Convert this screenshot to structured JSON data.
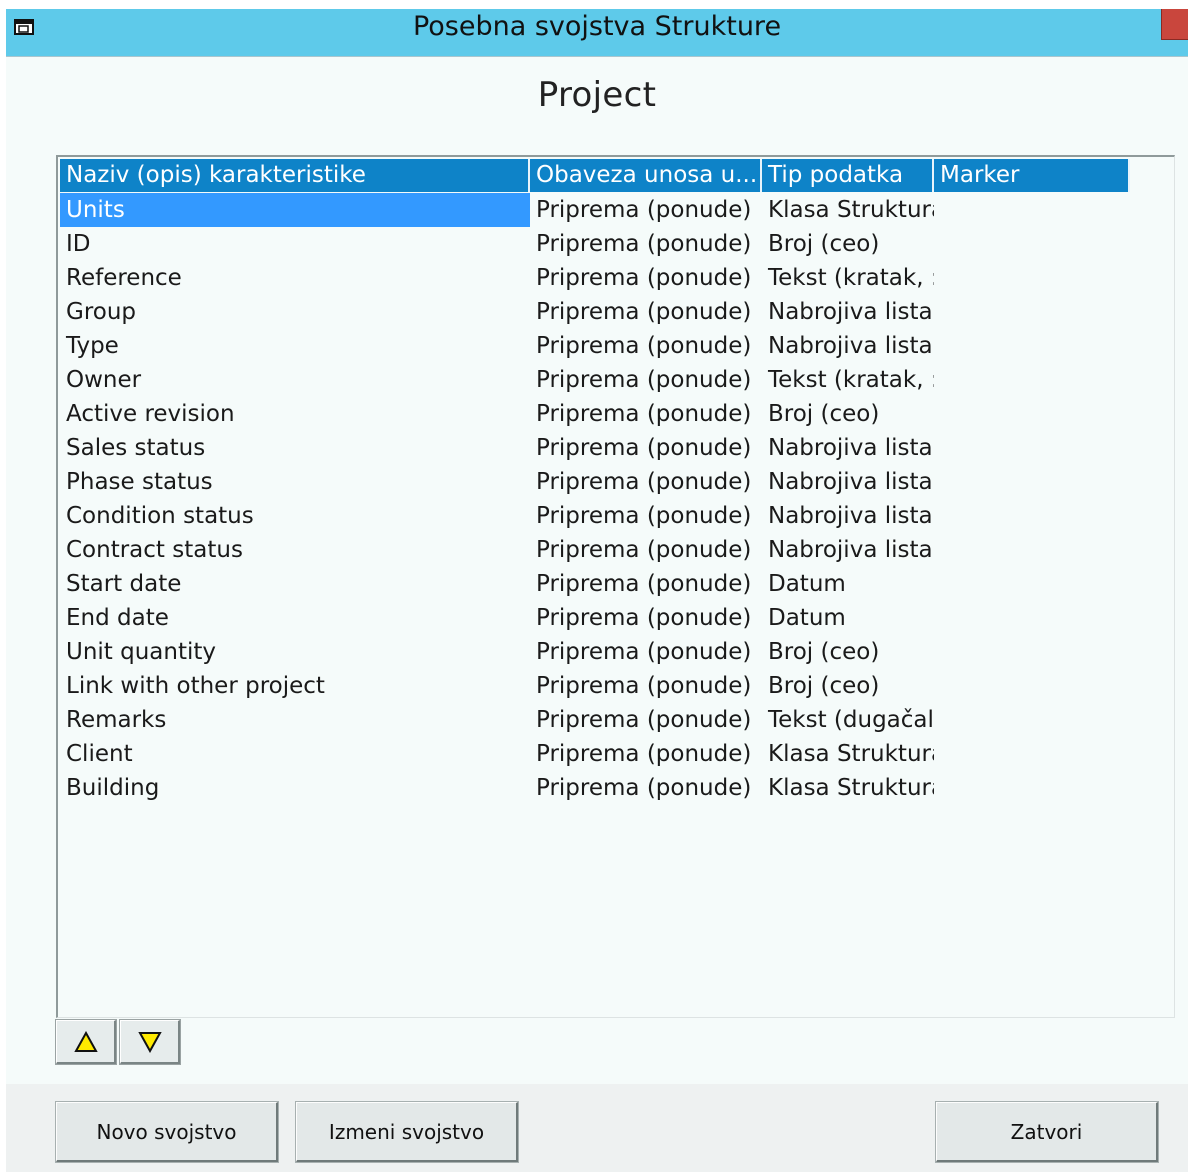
{
  "window": {
    "title": "Posebna svojstva Strukture",
    "icon": "window-app-icon",
    "accent_color": "#5ecaea"
  },
  "heading": "Project",
  "list": {
    "columns": [
      "Naziv (opis) karakteristike",
      "Obaveza unosa u...",
      "Tip podatka",
      "Marker"
    ],
    "header_color": "#0e83c8",
    "selected_color": "#3399ff",
    "selected_index": 0,
    "rows": [
      [
        "Units",
        "Priprema (ponude)",
        "Klasa Struktura",
        ""
      ],
      [
        "ID",
        "Priprema (ponude)",
        "Broj (ceo)",
        ""
      ],
      [
        "Reference",
        "Priprema (ponude)",
        "Tekst (kratak, :",
        ""
      ],
      [
        "Group",
        "Priprema (ponude)",
        "Nabrojiva lista",
        ""
      ],
      [
        "Type",
        "Priprema (ponude)",
        "Nabrojiva lista",
        ""
      ],
      [
        "Owner",
        "Priprema (ponude)",
        "Tekst (kratak, :",
        ""
      ],
      [
        "Active revision",
        "Priprema (ponude)",
        "Broj (ceo)",
        ""
      ],
      [
        "Sales status",
        "Priprema (ponude)",
        "Nabrojiva lista",
        ""
      ],
      [
        "Phase status",
        "Priprema (ponude)",
        "Nabrojiva lista",
        ""
      ],
      [
        "Condition status",
        "Priprema (ponude)",
        "Nabrojiva lista",
        ""
      ],
      [
        "Contract status",
        "Priprema (ponude)",
        "Nabrojiva lista",
        ""
      ],
      [
        "Start date",
        "Priprema (ponude)",
        "Datum",
        ""
      ],
      [
        "End date",
        "Priprema (ponude)",
        "Datum",
        ""
      ],
      [
        "Unit quantity",
        "Priprema (ponude)",
        "Broj (ceo)",
        ""
      ],
      [
        "Link with other project",
        "Priprema (ponude)",
        "Broj (ceo)",
        ""
      ],
      [
        "Remarks",
        "Priprema (ponude)",
        "Tekst (dugačal",
        ""
      ],
      [
        "Client",
        "Priprema (ponude)",
        "Klasa Struktura",
        ""
      ],
      [
        "Building",
        "Priprema (ponude)",
        "Klasa Struktura",
        ""
      ]
    ]
  },
  "reorder": {
    "up_icon": "triangle-up-icon",
    "down_icon": "triangle-down-icon",
    "icon_color": "#ffea00"
  },
  "buttons": {
    "new_property": "Novo svojstvo",
    "edit_property": "Izmeni svojstvo",
    "close": "Zatvori"
  }
}
